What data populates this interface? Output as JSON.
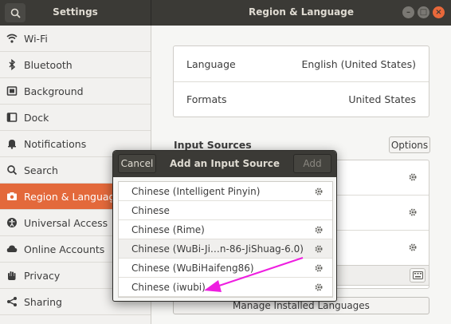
{
  "header": {
    "left_title": "Settings",
    "right_title": "Region & Language",
    "window_buttons": {
      "minimize": "–",
      "maximize": "□",
      "close": "×"
    }
  },
  "sidebar": {
    "items": [
      {
        "label": "Wi-Fi",
        "icon": "wifi-icon"
      },
      {
        "label": "Bluetooth",
        "icon": "bluetooth-icon"
      },
      {
        "label": "Background",
        "icon": "background-icon"
      },
      {
        "label": "Dock",
        "icon": "dock-icon"
      },
      {
        "label": "Notifications",
        "icon": "bell-icon"
      },
      {
        "label": "Search",
        "icon": "search-icon"
      },
      {
        "label": "Region & Language",
        "icon": "camera-icon",
        "active": true
      },
      {
        "label": "Universal Access",
        "icon": "accessibility-icon"
      },
      {
        "label": "Online Accounts",
        "icon": "online-accounts-icon"
      },
      {
        "label": "Privacy",
        "icon": "hand-icon"
      },
      {
        "label": "Sharing",
        "icon": "share-icon"
      }
    ]
  },
  "main": {
    "language": {
      "label": "Language",
      "value": "English (United States)"
    },
    "formats": {
      "label": "Formats",
      "value": "United States"
    },
    "input_sources_title": "Input Sources",
    "options_label": "Options",
    "manage_label": "Manage Installed Languages"
  },
  "dialog": {
    "title": "Add an Input Source",
    "cancel_label": "Cancel",
    "add_label": "Add",
    "items": [
      {
        "label": "Chinese (Intelligent Pinyin)",
        "has_settings": true
      },
      {
        "label": "Chinese",
        "has_settings": false
      },
      {
        "label": "Chinese (Rime)",
        "has_settings": true
      },
      {
        "label": "Chinese (WuBi-Ji…n-86-JiShuag-6.0)",
        "has_settings": true
      },
      {
        "label": "Chinese (WuBiHaifeng86)",
        "has_settings": true
      },
      {
        "label": "Chinese (iwubi)",
        "has_settings": true
      }
    ]
  },
  "colors": {
    "accent": "#e3693b",
    "headerbar": "#3b3a36",
    "arrow": "#ee1ee0"
  }
}
